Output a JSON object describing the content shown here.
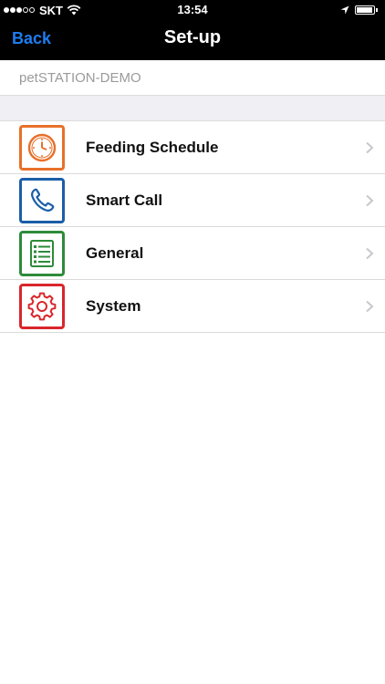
{
  "status_bar": {
    "carrier": "SKT",
    "time": "13:54",
    "signal_dots_full": 3,
    "signal_dots_total": 5,
    "battery_fraction": 0.95,
    "icons": [
      "wifi-icon",
      "location-arrow-icon",
      "battery-icon"
    ]
  },
  "nav": {
    "back_label": "Back",
    "title": "Set-up",
    "back_color": "#1f7cf0"
  },
  "device": {
    "name": "petSTATION-DEMO"
  },
  "menu": {
    "items": [
      {
        "label": "Feeding Schedule",
        "icon": "clock-icon",
        "color": "#e8702a"
      },
      {
        "label": "Smart Call",
        "icon": "phone-icon",
        "color": "#1a5ea8"
      },
      {
        "label": "General",
        "icon": "list-icon",
        "color": "#2e8b3a"
      },
      {
        "label": "System",
        "icon": "gear-icon",
        "color": "#d9262c"
      }
    ]
  }
}
